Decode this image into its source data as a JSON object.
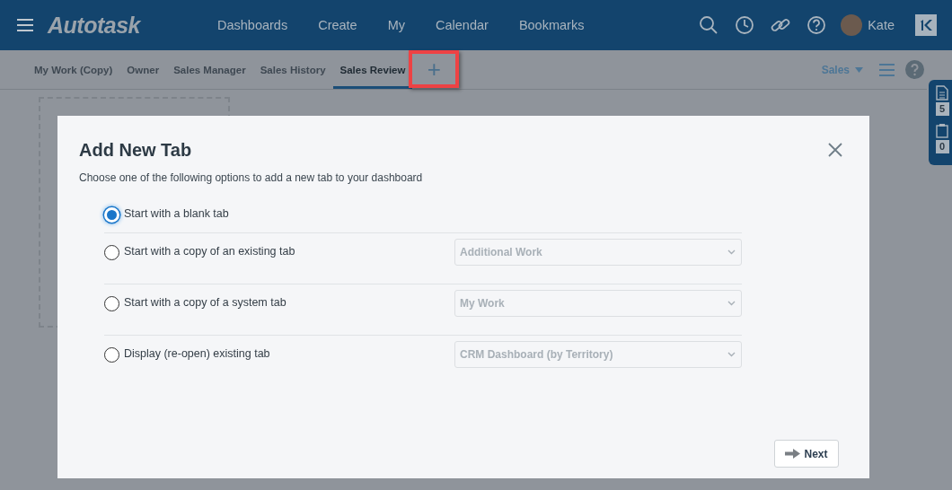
{
  "header": {
    "logo": "Autotask",
    "nav": [
      "Dashboards",
      "Create",
      "My",
      "Calendar",
      "Bookmarks"
    ],
    "user": "Kate"
  },
  "tabs": [
    {
      "label": "My Work (Copy)",
      "selected": false
    },
    {
      "label": "Owner",
      "selected": false
    },
    {
      "label": "Sales Manager",
      "selected": false
    },
    {
      "label": "Sales History",
      "selected": false
    },
    {
      "label": "Sales Review",
      "selected": true
    }
  ],
  "add_tab": "+",
  "category": "Sales",
  "side_panel": {
    "counts": [
      "5",
      "0"
    ]
  },
  "dialog": {
    "title": "Add New Tab",
    "subtitle": "Choose one of the following options to add a new tab to your dashboard",
    "options": [
      {
        "label": "Start with a blank tab",
        "selected": true
      },
      {
        "label": "Start with a copy of an existing tab",
        "selected": false,
        "dropdown": "Additional Work"
      },
      {
        "label": "Start with a copy of a system tab",
        "selected": false,
        "dropdown": "My Work"
      },
      {
        "label": "Display (re-open) existing tab",
        "selected": false,
        "dropdown": "CRM Dashboard (by Territory)"
      }
    ],
    "next": "Next"
  }
}
